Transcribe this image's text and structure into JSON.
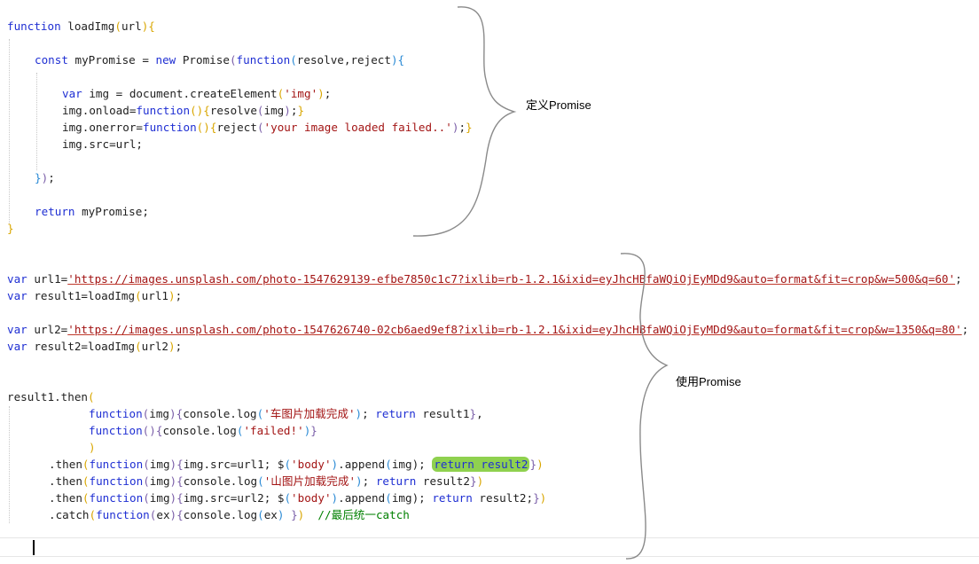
{
  "code": {
    "l1": [
      "function",
      "loadImg",
      "(",
      "url",
      ")",
      "{"
    ],
    "l2": [
      "const",
      "myPromise = ",
      "new",
      " Promise",
      "(",
      "function",
      "(",
      "resolve,reject",
      ")",
      "{"
    ],
    "l3": [
      "var",
      " img = document.createElement",
      "(",
      "'img'",
      ")",
      ";"
    ],
    "l4": [
      "img.onload=",
      "function",
      "()",
      "{",
      "resolve",
      "(",
      "img",
      ")",
      ";",
      "}"
    ],
    "l5": [
      "img.onerror=",
      "function",
      "()",
      "{",
      "reject",
      "(",
      "'your image loaded failed..'",
      ")",
      ";",
      "}"
    ],
    "l6": [
      "img.src=url;"
    ],
    "l7": [
      "}",
      ")",
      ";"
    ],
    "l8": [
      "return",
      " myPromise;"
    ],
    "l9": [
      "}"
    ],
    "l10": [
      "var",
      " url1=",
      "'https://images.unsplash.com/photo-1547629139-efbe7850c1c7?ixlib=rb-1.2.1&ixid=eyJhcHBfaWQiOjEyMDd9&auto=format&fit=crop&w=500&q=60'",
      ";"
    ],
    "l11": [
      "var",
      " result1=loadImg",
      "(",
      "url1",
      ")",
      ";"
    ],
    "l12": [
      "var",
      " url2=",
      "'https://images.unsplash.com/photo-1547626740-02cb6aed9ef8?ixlib=rb-1.2.1&ixid=eyJhcHBfaWQiOjEyMDd9&auto=format&fit=crop&w=1350&q=80'",
      ";"
    ],
    "l13": [
      "var",
      " result2=loadImg",
      "(",
      "url2",
      ")",
      ";"
    ],
    "l14": [
      "result1.then",
      "("
    ],
    "l15": [
      "function",
      "(",
      "img",
      ")",
      "{",
      "console.log",
      "(",
      "'车图片加载完成'",
      ")",
      "; ",
      "return",
      " result1",
      "}",
      ","
    ],
    "l16": [
      "function",
      "()",
      "{",
      "console.log",
      "(",
      "'failed!'",
      ")",
      "}"
    ],
    "l17": [
      ")"
    ],
    "l18": [
      ".then",
      "(",
      "function",
      "(",
      "img",
      ")",
      "{",
      "img.src=url1; $",
      "(",
      "'body'",
      ")",
      ".append",
      "(",
      "img",
      ");",
      " ",
      "return result2",
      "}",
      ")"
    ],
    "l19": [
      ".then",
      "(",
      "function",
      "(",
      "img",
      ")",
      "{",
      "console.log",
      "(",
      "'山图片加载完成'",
      ")",
      "; ",
      "return",
      " result2",
      "}",
      ")"
    ],
    "l20": [
      ".then",
      "(",
      "function",
      "(",
      "img",
      ")",
      "{",
      "img.src=url2; $",
      "(",
      "'body'",
      ")",
      ".append",
      "(",
      "img",
      ");",
      " ",
      "return",
      " result2;",
      "}",
      ")"
    ],
    "l21": [
      ".catch",
      "(",
      "function",
      "(",
      "ex",
      ")",
      "{",
      "console.log",
      "(",
      "ex",
      ")",
      " ",
      "}",
      ")",
      "  //最后统一catch"
    ]
  },
  "annotations": {
    "define": "定义Promise",
    "use": "使用Promise"
  }
}
